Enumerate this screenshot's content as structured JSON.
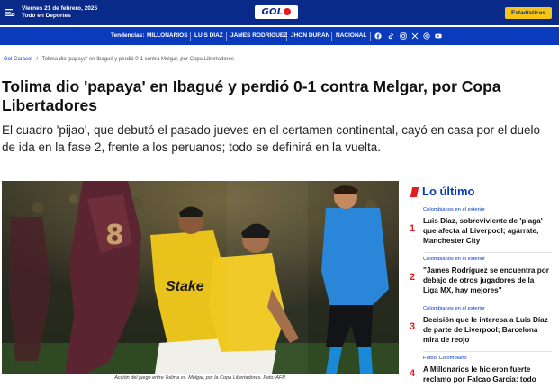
{
  "header": {
    "date_line1": "Viernes 21 de febrero, 2025",
    "date_line2": "Todo en Deportes",
    "logo_text": "GOL",
    "stats_button": "Estadísticas",
    "menu_icon": "hamburger-menu-icon"
  },
  "trends": {
    "label": "Tendencias:",
    "items": [
      "MILLONARIOS",
      "LUIS DÍAZ",
      "JAMES RODRÍGUEZ",
      "JHON DURÁN",
      "NACIONAL"
    ],
    "social_icons": [
      "facebook-icon",
      "tiktok-icon",
      "instagram-icon",
      "x-icon",
      "threads-icon",
      "youtube-icon"
    ]
  },
  "breadcrumb": {
    "home": "Gol Caracol",
    "separator": "/",
    "current": "Tolima dio 'papaya' en Ibagué y perdió 0-1 contra Melgar, por Copa Libertadores"
  },
  "article": {
    "title": "Tolima dio 'papaya' en Ibagué y perdió 0-1 contra Melgar, por Copa Libertadores",
    "lead": "El cuadro 'pijao', que debutó el pasado jueves en el certamen continental, cayó en casa por el duelo de ida en la fase 2, frente a los peruanos; todo se definirá en la vuelta.",
    "caption": "Acción del juego entre Tolima vs. Melgar, por la Copa Libertadores.  Foto: AFP.",
    "photo_texts": {
      "sponsor": "Stake",
      "number": "8"
    }
  },
  "sidebar": {
    "title": "Lo último",
    "items": [
      {
        "num": "1",
        "category": "Colombianos en el exterior",
        "text": "Luis Díaz, sobreviviente de 'plaga' que afecta al Liverpool; agárrate, Manchester City"
      },
      {
        "num": "2",
        "category": "Colombianos en el exterior",
        "text": "\"James Rodríguez se encuentra por debajo de otros jugadores de la Liga MX, hay mejores\""
      },
      {
        "num": "3",
        "category": "Colombianos en el exterior",
        "text": "Decisión que le interesa a Luis Díaz de parte de Liverpool; Barcelona mira de reojo"
      },
      {
        "num": "4",
        "category": "Fútbol Colombiano",
        "text": "A Millonarios le hicieron fuerte reclamo por Falcao García: todo"
      }
    ]
  },
  "colors": {
    "primary_blue": "#0a2a8a",
    "trend_blue": "#0a3bbd",
    "accent_red": "#e31b23",
    "stats_yellow": "#f5c518"
  }
}
